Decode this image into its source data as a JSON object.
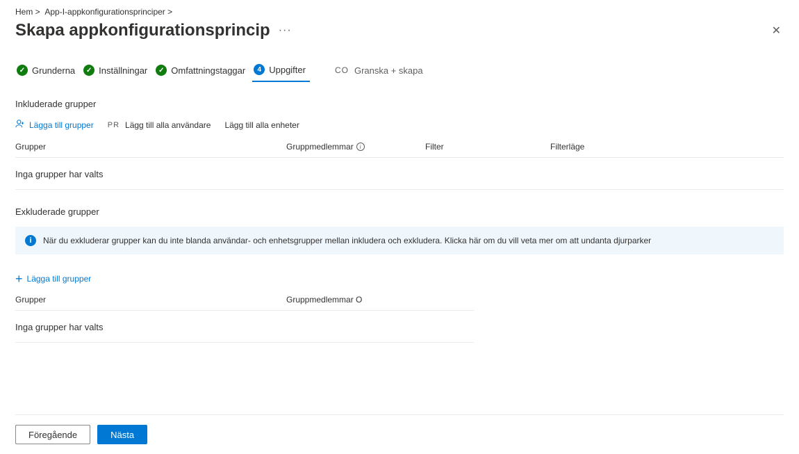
{
  "breadcrumb": {
    "home": "Hem >",
    "path": "App-I-appkonfigurationsprinciper >"
  },
  "header": {
    "title": "Skapa appkonfigurationsprincip",
    "more": "···",
    "close": "✕"
  },
  "stepper": {
    "step1": "Grunderna",
    "step2": "Inställningar",
    "step3": "Omfattningstaggar",
    "step4_num": "4",
    "step4": "Uppgifter",
    "step5_prefix": "CO",
    "step5": "Granska + skapa"
  },
  "included": {
    "title": "Inkluderade grupper",
    "add_groups": "Lägga till grupper",
    "add_users_prefix": "PR",
    "add_users": "Lägg till alla användare",
    "add_devices": "Lägg till alla enheter",
    "col_groups": "Grupper",
    "col_members": "Gruppmedlemmar",
    "col_filter": "Filter",
    "col_filtermode": "Filterläge",
    "empty": "Inga grupper har valts"
  },
  "excluded": {
    "title": "Exkluderade grupper",
    "info": "När du exkluderar grupper kan du inte blanda användar- och enhetsgrupper mellan inkludera och exkludera. Klicka här om du vill veta mer om att undanta djurparker",
    "add_groups": "Lägga till grupper",
    "col_groups": "Grupper",
    "col_members": "Gruppmedlemmar O",
    "empty": "Inga grupper har valts"
  },
  "footer": {
    "prev": "Föregående",
    "next": "Nästa"
  }
}
